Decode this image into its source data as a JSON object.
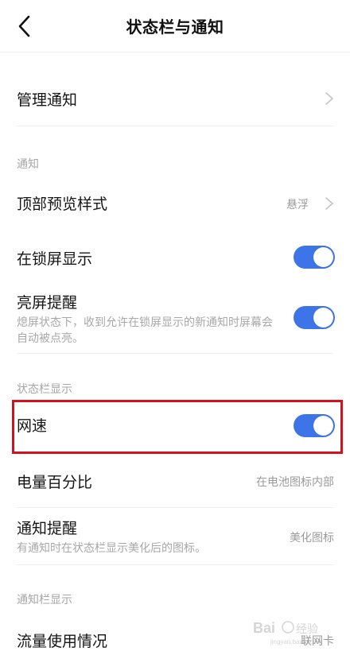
{
  "header": {
    "title": "状态栏与通知"
  },
  "manage_notifications": {
    "label": "管理通知"
  },
  "section_notifications": {
    "header": "通知",
    "top_preview": {
      "label": "顶部预览样式",
      "value": "悬浮"
    },
    "lockscreen_display": {
      "label": "在锁屏显示",
      "enabled": true
    },
    "wake_screen": {
      "label": "亮屏提醒",
      "description": "熄屏状态下，收到允许在锁屏显示的新通知时屏幕会自动被点亮。",
      "enabled": true
    }
  },
  "section_statusbar": {
    "header": "状态栏显示",
    "network_speed": {
      "label": "网速",
      "enabled": true
    },
    "battery_percent": {
      "label": "电量百分比",
      "value": "在电池图标内部"
    },
    "notification_reminder": {
      "label": "通知提醒",
      "description": "有通知时在状态栏显示美化后的图标。",
      "value": "美化图标"
    }
  },
  "section_notification_bar": {
    "header": "通知栏显示",
    "data_usage": {
      "label": "流量使用情况",
      "value": "联网卡"
    }
  },
  "watermark": {
    "brand": "Bai",
    "brand_suffix": "经验",
    "url": "jingyan.baidu.com"
  },
  "colors": {
    "toggle_on": "#3d74e8",
    "highlight": "#d4121e"
  }
}
